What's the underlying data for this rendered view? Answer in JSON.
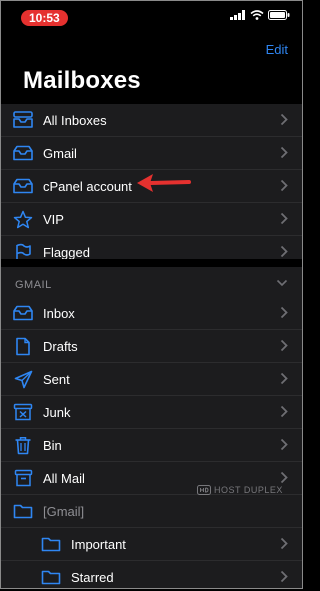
{
  "status": {
    "time": "10:53"
  },
  "header": {
    "edit_label": "Edit",
    "title": "Mailboxes"
  },
  "mailboxes": [
    {
      "label": "All Inboxes",
      "icon": "inbox-stack-icon"
    },
    {
      "label": "Gmail",
      "icon": "inbox-icon"
    },
    {
      "label": "cPanel account",
      "icon": "inbox-icon"
    },
    {
      "label": "VIP",
      "icon": "star-icon"
    },
    {
      "label": "Flagged",
      "icon": "flag-icon"
    }
  ],
  "gmail_section": {
    "header": "GMAIL",
    "items": [
      {
        "label": "Inbox",
        "icon": "inbox-icon"
      },
      {
        "label": "Drafts",
        "icon": "document-icon"
      },
      {
        "label": "Sent",
        "icon": "paper-plane-icon"
      },
      {
        "label": "Junk",
        "icon": "junk-icon"
      },
      {
        "label": "Bin",
        "icon": "trash-icon"
      },
      {
        "label": "All Mail",
        "icon": "archive-icon"
      },
      {
        "label": "[Gmail]",
        "icon": "folder-icon"
      },
      {
        "label": "Important",
        "icon": "folder-icon"
      },
      {
        "label": "Starred",
        "icon": "folder-icon"
      }
    ]
  },
  "watermark": "HOST DUPLEX",
  "colors": {
    "accent": "#2f86f2",
    "arrow": "#e5312f",
    "time_pill": "#e5312f"
  }
}
